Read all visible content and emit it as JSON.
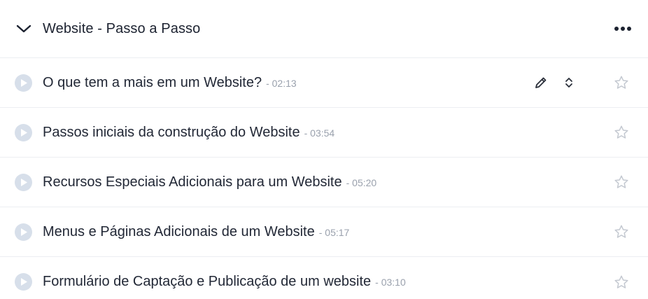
{
  "module": {
    "title": "Website - Passo a Passo",
    "icons": {
      "collapse": "chevron-down-icon",
      "more": "more-horizontal-icon",
      "play": "play-icon",
      "edit": "pencil-icon",
      "reorder": "reorder-icon",
      "favorite": "star-icon"
    },
    "colors": {
      "play_circle": "#d7dfea",
      "play_triangle": "#ffffff",
      "star_outline": "#c3c8d0",
      "divider": "#eceef2",
      "duration_text": "#9aa1ad"
    }
  },
  "lessons": [
    {
      "title": "O que tem a mais em um Website?",
      "duration": "- 02:13"
    },
    {
      "title": "Passos iniciais da construção do Website",
      "duration": "- 03:54"
    },
    {
      "title": "Recursos Especiais Adicionais para um Website",
      "duration": "- 05:20"
    },
    {
      "title": "Menus e Páginas Adicionais de um Website",
      "duration": "- 05:17"
    },
    {
      "title": "Formulário de Captação e Publicação de um website",
      "duration": "- 03:10"
    }
  ]
}
